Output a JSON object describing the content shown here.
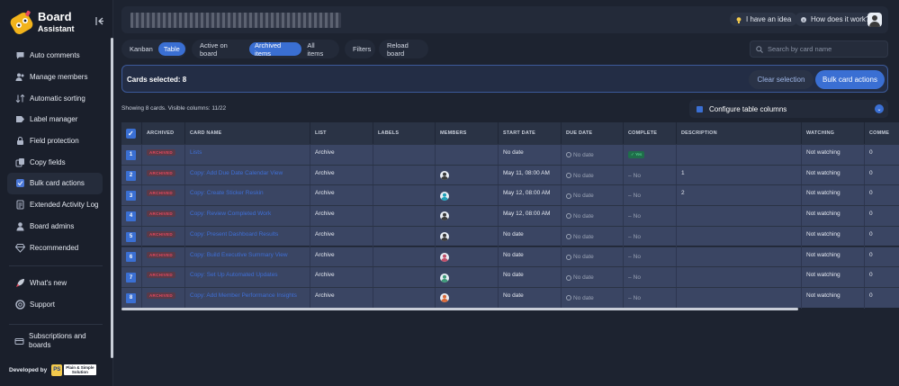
{
  "app": {
    "name_line1": "Board",
    "name_line2": "Assistant"
  },
  "sidebar": {
    "items": [
      {
        "label": "Auto comments",
        "icon": "comment-icon"
      },
      {
        "label": "Manage members",
        "icon": "members-icon"
      },
      {
        "label": "Automatic sorting",
        "icon": "sort-icon"
      },
      {
        "label": "Label manager",
        "icon": "label-icon"
      },
      {
        "label": "Field protection",
        "icon": "lock-icon"
      },
      {
        "label": "Copy fields",
        "icon": "copy-icon"
      },
      {
        "label": "Bulk card actions",
        "icon": "bulk-icon"
      },
      {
        "label": "Extended Activity Log",
        "icon": "log-icon"
      },
      {
        "label": "Board admins",
        "icon": "admin-icon"
      },
      {
        "label": "Recommended",
        "icon": "diamond-icon"
      }
    ],
    "secondary": [
      {
        "label": "What's new",
        "icon": "rocket-icon"
      },
      {
        "label": "Support",
        "icon": "support-icon"
      }
    ],
    "subscriptions": "Subscriptions and boards",
    "developed_by": "Developed by",
    "dev_logo": "PS",
    "dev_name_1": "Plain & Simple",
    "dev_name_2": "Solution"
  },
  "header": {
    "idea_label": "I have an idea",
    "how_label": "How does it work?"
  },
  "toolbar": {
    "view_tabs": [
      "Kanban",
      "Table"
    ],
    "filter_tabs": [
      "Active on board",
      "Archived items",
      "All items"
    ],
    "filters_label": "Filters",
    "reload_label": "Reload board",
    "search_placeholder": "Search by card name"
  },
  "selection": {
    "text": "Cards selected: 8",
    "clear_label": "Clear selection",
    "bulk_label": "Bulk card actions"
  },
  "showing_text": "Showing 8 cards. Visible columns: 11/22",
  "config_label": "Configure table columns",
  "table": {
    "headers": [
      "ARCHIVED",
      "CARD NAME",
      "LIST",
      "LABELS",
      "MEMBERS",
      "START DATE",
      "DUE DATE",
      "COMPLETE",
      "DESCRIPTION",
      "WATCHING",
      "COMME"
    ],
    "rows": [
      {
        "idx": "1",
        "archived": "ARCHIVED",
        "name": "Lists",
        "list": "Archive",
        "member": "",
        "start": "No date",
        "due": "No date",
        "complete": "Yes",
        "desc": "",
        "watching": "Not watching",
        "comments": "0",
        "member_color": ""
      },
      {
        "idx": "2",
        "archived": "ARCHIVED",
        "name": "Copy: Add Due Date Calendar View",
        "list": "Archive",
        "member": "m",
        "start": "May 11, 08:00 AM",
        "due": "No date",
        "complete": "No",
        "desc": "1",
        "watching": "Not watching",
        "comments": "0",
        "member_color": "#3a3a3a"
      },
      {
        "idx": "3",
        "archived": "ARCHIVED",
        "name": "Copy: Create Sticker Reskin",
        "list": "Archive",
        "member": "m",
        "start": "May 12, 08:00 AM",
        "due": "No date",
        "complete": "No",
        "desc": "2",
        "watching": "Not watching",
        "comments": "0",
        "member_color": "#1fa0b8"
      },
      {
        "idx": "4",
        "archived": "ARCHIVED",
        "name": "Copy: Review Completed Work",
        "list": "Archive",
        "member": "m",
        "start": "May 12, 08:00 AM",
        "due": "No date",
        "complete": "No",
        "desc": "",
        "watching": "Not watching",
        "comments": "0",
        "member_color": "#3a3a3a"
      },
      {
        "idx": "5",
        "archived": "ARCHIVED",
        "name": "Copy: Present Dashboard Results",
        "list": "Archive",
        "member": "m",
        "start": "No date",
        "due": "No date",
        "complete": "No",
        "desc": "",
        "watching": "Not watching",
        "comments": "0",
        "member_color": "#3a3a3a"
      },
      {
        "idx": "6",
        "archived": "ARCHIVED",
        "name": "Copy: Build Executive Summary View",
        "list": "Archive",
        "member": "m",
        "start": "No date",
        "due": "No date",
        "complete": "No",
        "desc": "",
        "watching": "Not watching",
        "comments": "0",
        "member_color": "#c0506a"
      },
      {
        "idx": "7",
        "archived": "ARCHIVED",
        "name": "Copy: Set Up Automated Updates",
        "list": "Archive",
        "member": "m",
        "start": "No date",
        "due": "No date",
        "complete": "No",
        "desc": "",
        "watching": "Not watching",
        "comments": "0",
        "member_color": "#3f9a7a"
      },
      {
        "idx": "8",
        "archived": "ARCHIVED",
        "name": "Copy: Add Member Performance Insights",
        "list": "Archive",
        "member": "m",
        "start": "No date",
        "due": "No date",
        "complete": "No",
        "desc": "",
        "watching": "Not watching",
        "comments": "0",
        "member_color": "#d96a3a"
      }
    ]
  },
  "colors": {
    "accent": "#3a6fd3",
    "archived": "#e5485d",
    "row": "#3a4563",
    "link": "#3f6fd6"
  }
}
